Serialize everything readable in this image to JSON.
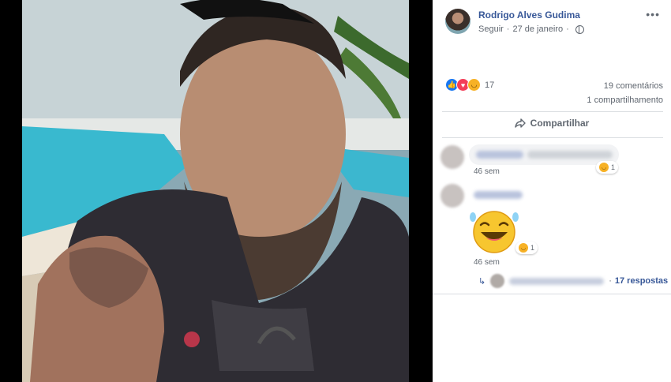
{
  "post": {
    "author": "Rodrigo Alves Gudima",
    "follow": "Seguir",
    "date": "27 de janeiro",
    "reaction_count": "17",
    "comments": "19 comentários",
    "shares": "1 compartilhamento",
    "share_label": "Compartilhar"
  },
  "comments": [
    {
      "time": "46 sem",
      "reaction_count": "1"
    },
    {
      "time": "46 sem",
      "reaction_count": "1"
    }
  ],
  "replies": {
    "separator": "·",
    "count": "17 respostas"
  },
  "colors": {
    "link": "#385898",
    "meta": "#606770",
    "like": "#1877f2",
    "love": "#f33e58",
    "haha": "#f7b125"
  }
}
